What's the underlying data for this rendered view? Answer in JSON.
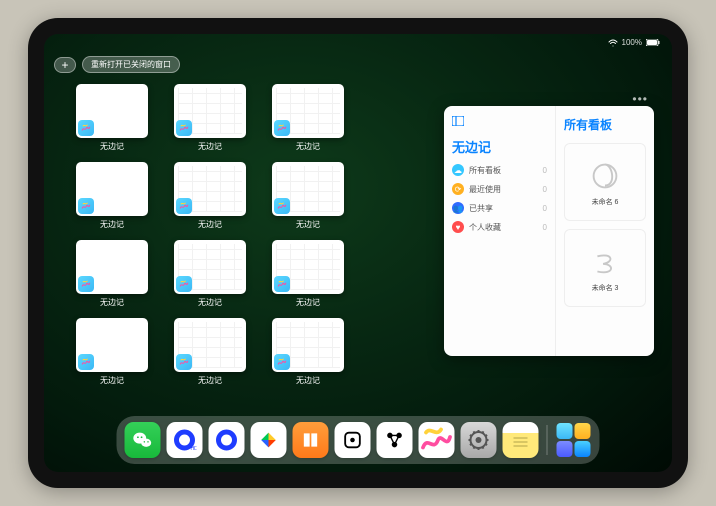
{
  "status": {
    "battery": "100%",
    "wifi_icon": "wifi-icon"
  },
  "topbar": {
    "plus_label": "+",
    "reopen_label": "重新打开已关闭的窗口"
  },
  "app_name": "无边记",
  "windows": [
    {
      "label": "无边记",
      "style": "blank"
    },
    {
      "label": "无边记",
      "style": "grid"
    },
    {
      "label": "无边记",
      "style": "grid"
    },
    {
      "label": "无边记",
      "style": "blank"
    },
    {
      "label": "无边记",
      "style": "grid"
    },
    {
      "label": "无边记",
      "style": "grid"
    },
    {
      "label": "无边记",
      "style": "blank"
    },
    {
      "label": "无边记",
      "style": "grid"
    },
    {
      "label": "无边记",
      "style": "grid"
    },
    {
      "label": "无边记",
      "style": "blank"
    },
    {
      "label": "无边记",
      "style": "grid"
    },
    {
      "label": "无边记",
      "style": "grid"
    }
  ],
  "panel": {
    "left_title": "无边记",
    "right_title": "所有看板",
    "items": [
      {
        "label": "所有看板",
        "count": 0,
        "color": "#34c7ff"
      },
      {
        "label": "最近使用",
        "count": 0,
        "color": "#ffb020"
      },
      {
        "label": "已共享",
        "count": 0,
        "color": "#2f6bff"
      },
      {
        "label": "个人收藏",
        "count": 0,
        "color": "#ff4d4d"
      }
    ],
    "boards": [
      {
        "name": "未命名 6",
        "time": ""
      },
      {
        "name": "未命名 3",
        "time": ""
      }
    ]
  },
  "dock": [
    {
      "name": "wechat",
      "bg": "linear-gradient(#34d058,#18b93b)"
    },
    {
      "name": "quark-hd",
      "bg": "#fff"
    },
    {
      "name": "quark",
      "bg": "#fff"
    },
    {
      "name": "play",
      "bg": "#fff"
    },
    {
      "name": "books",
      "bg": "linear-gradient(#ff9d3b,#ff7a1a)"
    },
    {
      "name": "dice",
      "bg": "#fff"
    },
    {
      "name": "connect",
      "bg": "#fff"
    },
    {
      "name": "freeform",
      "bg": "#fff"
    },
    {
      "name": "settings",
      "bg": "linear-gradient(#d8d8d8,#a8a8a8)"
    },
    {
      "name": "notes",
      "bg": "linear-gradient(#fff 0 30%,#ffe97a 30% 100%)"
    }
  ]
}
